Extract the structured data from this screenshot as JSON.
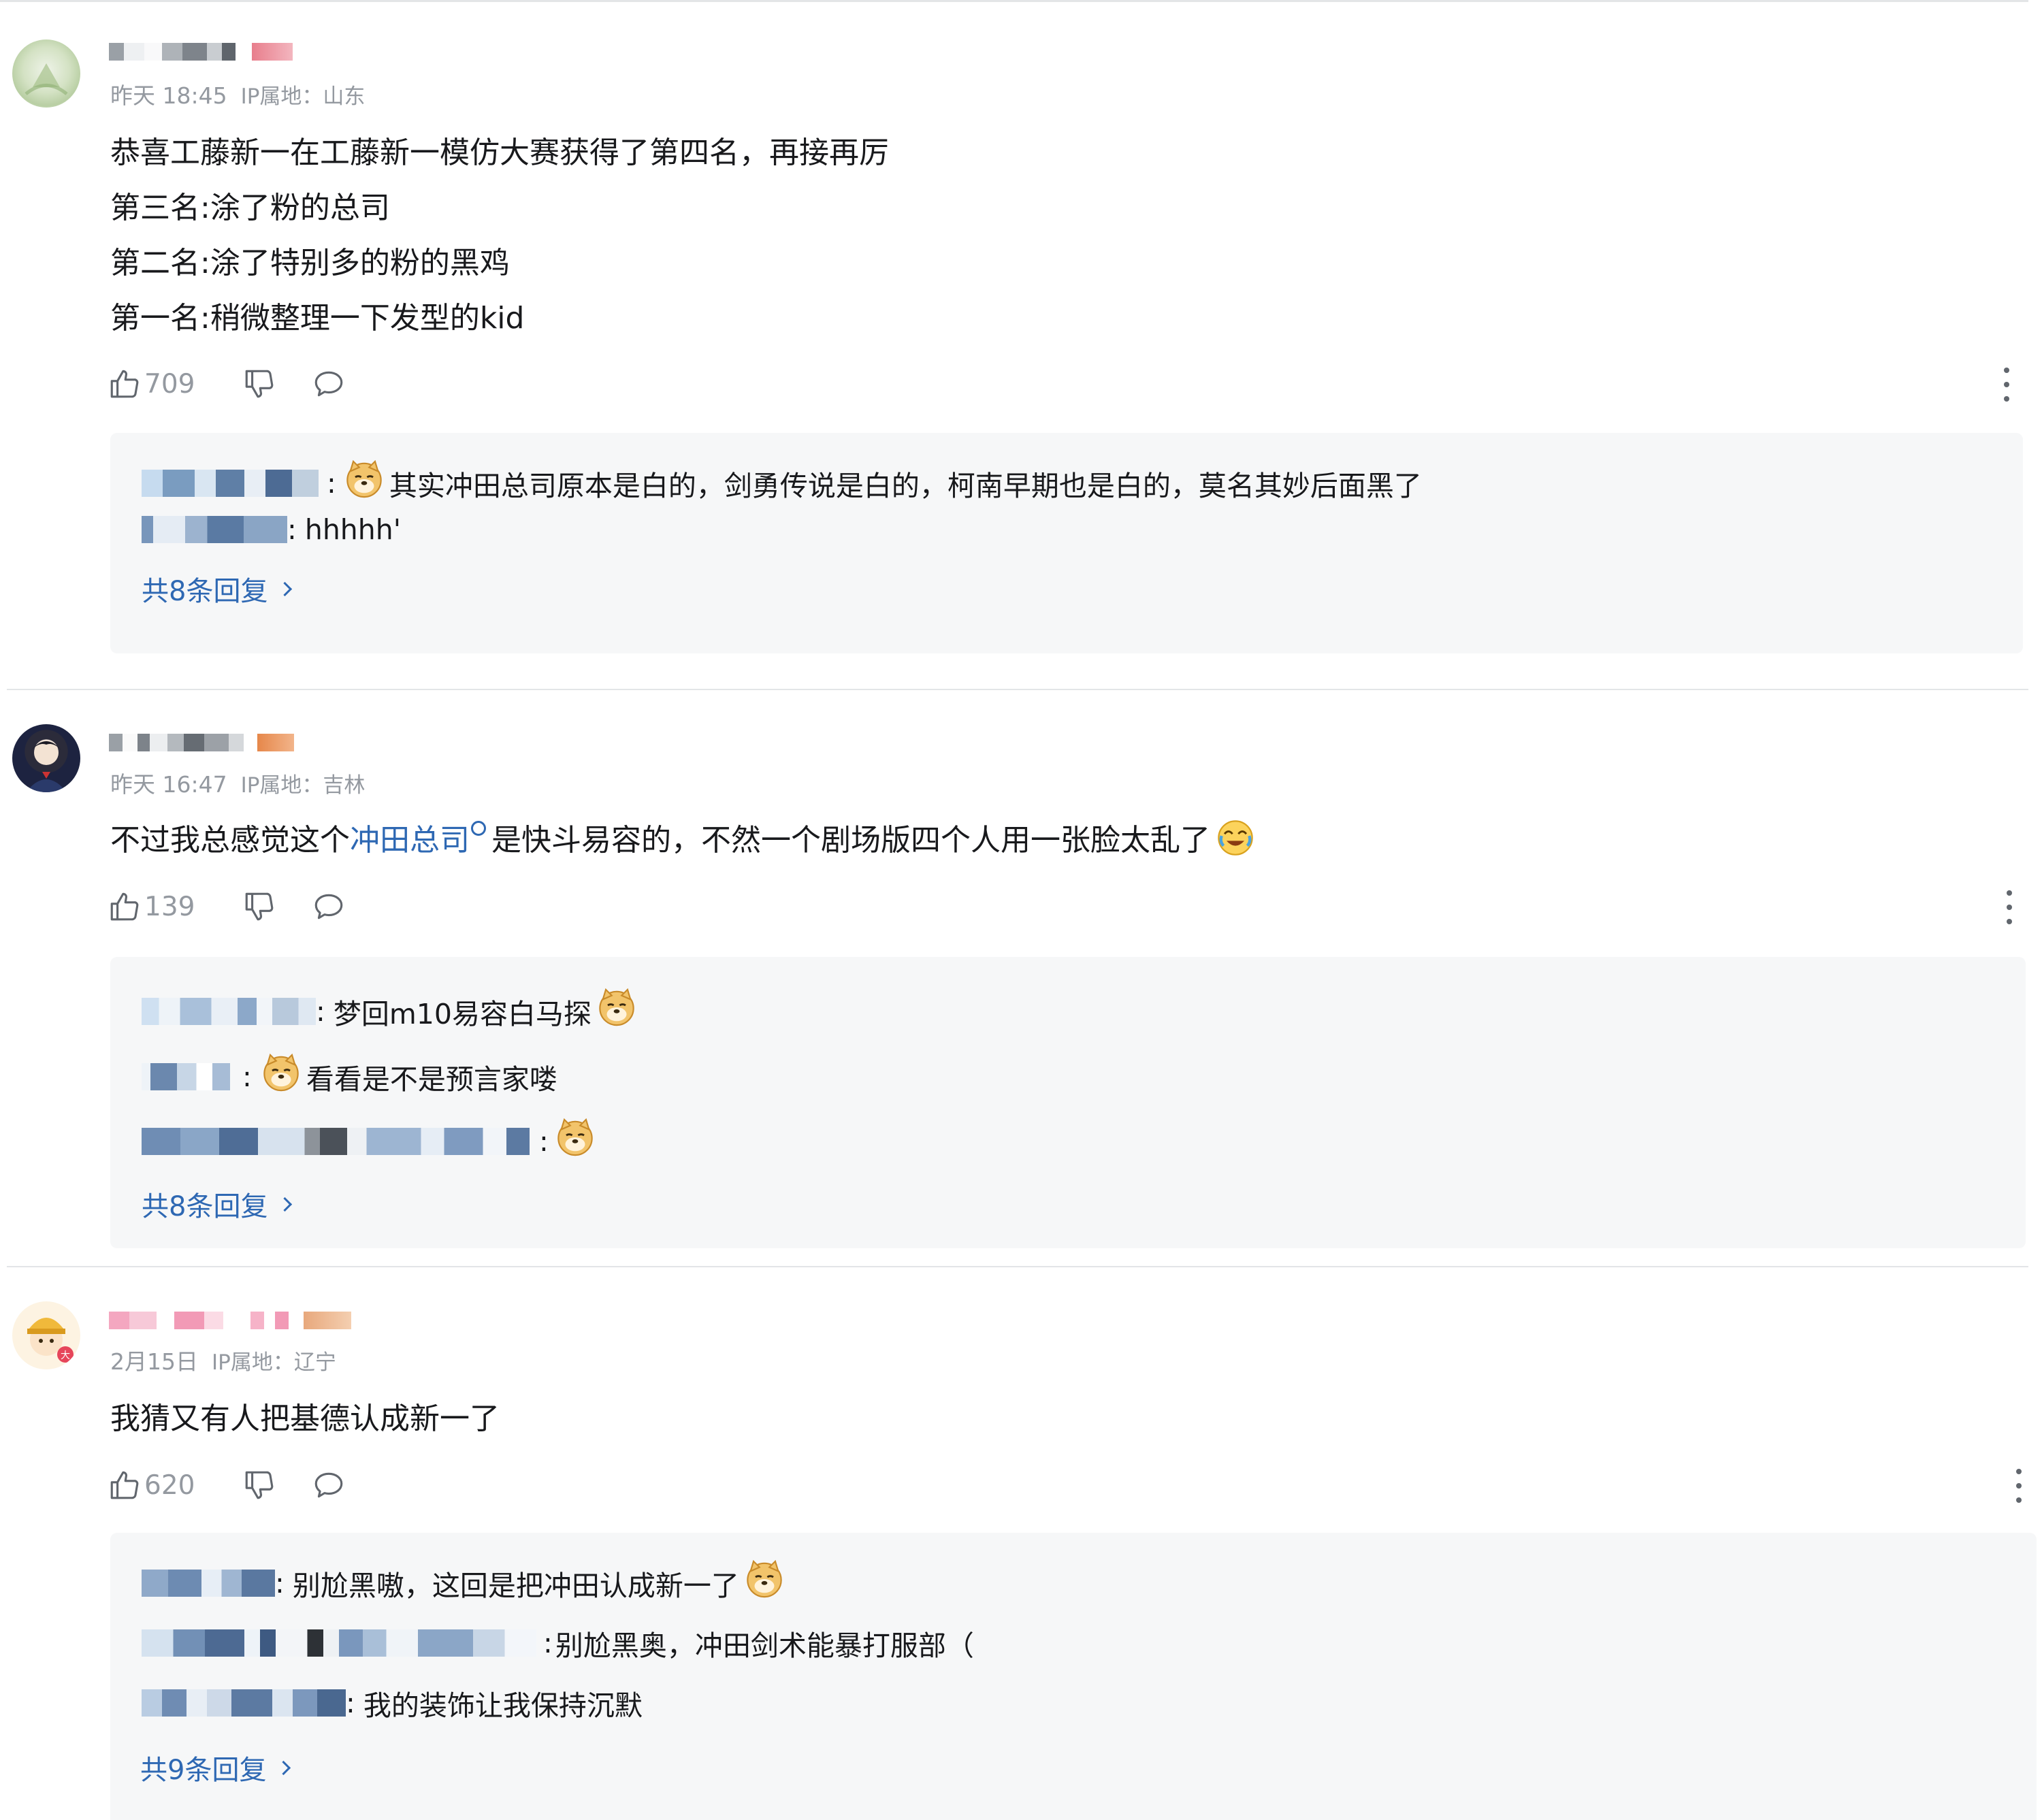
{
  "comments": [
    {
      "time": "昨天 18:45",
      "ip": "IP属地：山东",
      "lines": [
        "恭喜工藤新一在工藤新一模仿大赛获得了第四名，再接再厉",
        "第三名:涂了粉的总司",
        "第二名:涂了特别多的粉的黑鸡",
        "第一名:稍微整理一下发型的kid"
      ],
      "likes": "709",
      "replies": [
        {
          "sep": ":",
          "text": "其实冲田总司原本是白的，剑勇传说是白的，柯南早期也是白的，莫名其妙后面黑了"
        },
        {
          "sep": ":",
          "text": "hhhhh'"
        }
      ],
      "view_all": "共8条回复"
    },
    {
      "time": "昨天 16:47",
      "ip": "IP属地：吉林",
      "text_before": "不过我总感觉这个",
      "link": "冲田总司",
      "text_after": "是快斗易容的，不然一个剧场版四个人用一张脸太乱了",
      "likes": "139",
      "replies": [
        {
          "sep": ":",
          "text": "梦回m10易容白马探"
        },
        {
          "sep": ":",
          "text": "看看是不是预言家喽"
        },
        {
          "sep": ":",
          "text": ""
        }
      ],
      "view_all": "共8条回复"
    },
    {
      "time": "2月15日",
      "ip": "IP属地：辽宁",
      "lines": [
        "我猜又有人把基德认成新一了"
      ],
      "likes": "620",
      "replies": [
        {
          "sep": ":",
          "text": "别尬黑嗷，这回是把冲田认成新一了"
        },
        {
          "sep": ":",
          "text": "别尬黑奥，冲田剑术能暴打服部（"
        },
        {
          "sep": ":",
          "text": "我的装饰让我保持沉默"
        }
      ],
      "view_all": "共9条回复"
    }
  ],
  "icons": {
    "like": "thumbs-up-icon",
    "dislike": "thumbs-down-icon",
    "reply": "speech-bubble-icon",
    "more": "vertical-dots-icon",
    "emoji": "doge-emoji-icon",
    "cry_emoji": "crying-laugh-emoji-icon"
  },
  "colors": {
    "link": "#2e68b3",
    "meta": "#9499a0",
    "reply_bg": "#f6f7f8",
    "divider": "#e3e5e7"
  }
}
